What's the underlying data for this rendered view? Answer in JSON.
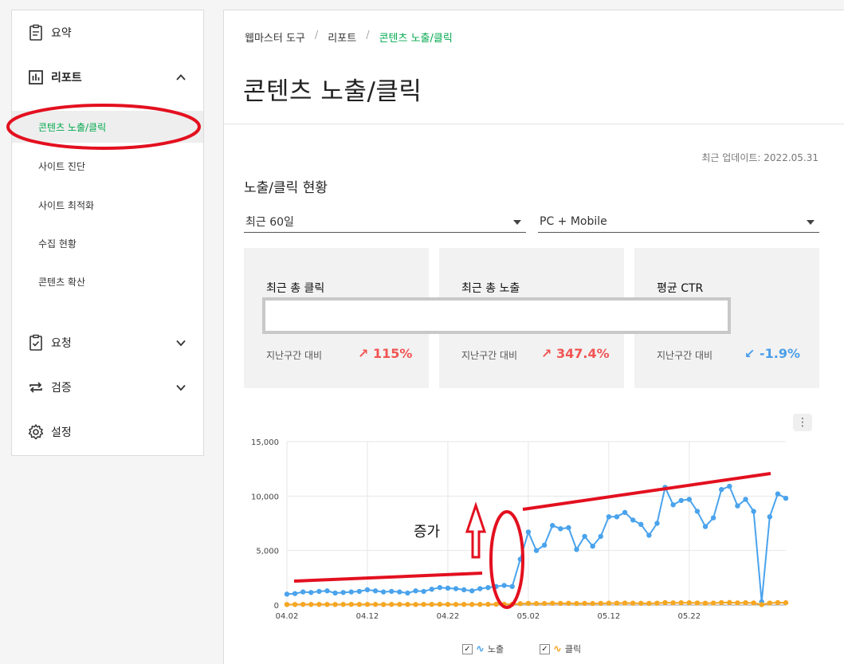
{
  "sidebar": {
    "summary": "요약",
    "report": "리포트",
    "report_sub": [
      "콘텐츠 노출/클릭",
      "사이트 진단",
      "사이트 최적화",
      "수집 현황",
      "콘텐츠 확산"
    ],
    "request": "요청",
    "verify": "검증",
    "settings": "설정"
  },
  "breadcrumb": [
    "웹마스터 도구",
    "리포트",
    "콘텐츠 노출/클릭"
  ],
  "page_title": "콘텐츠 노출/클릭",
  "last_updated": "최근 업데이트: 2022.05.31",
  "section_title": "노출/클릭 현황",
  "filters": {
    "period": "최근 60일",
    "device": "PC + Mobile"
  },
  "cards": [
    {
      "title": "최근 총 클릭",
      "label": "지난구간 대비",
      "change": "↗ 115%",
      "trend": "up"
    },
    {
      "title": "최근 총 노출",
      "label": "지난구간 대비",
      "change": "↗ 347.4%",
      "trend": "up"
    },
    {
      "title": "평균 CTR",
      "label": "지난구간 대비",
      "change": "↙ -1.9%",
      "trend": "down"
    }
  ],
  "menu_icon": "⋮",
  "annotation": "증가",
  "legend": [
    {
      "name": "노출",
      "color": "#4aa3ec",
      "checked": true
    },
    {
      "name": "클릭",
      "color": "#f5a623",
      "checked": true
    }
  ],
  "colors": {
    "accent": "#03a94f",
    "up": "#f25454",
    "down": "#4a9ee8",
    "annotation": "#e3101f"
  },
  "chart_data": {
    "type": "line",
    "x_tick_labels": [
      "04.02",
      "04.12",
      "04.22",
      "05.02",
      "05.12",
      "05.22"
    ],
    "y_tick_labels": [
      "0",
      "5,000",
      "10,000",
      "15,000"
    ],
    "ylim": [
      0,
      15000
    ],
    "grid": true,
    "legend": "bottom",
    "series": [
      {
        "name": "노출",
        "color": "#4aa3ec",
        "values": [
          1000,
          1050,
          1200,
          1150,
          1250,
          1300,
          1100,
          1150,
          1200,
          1250,
          1400,
          1300,
          1200,
          1250,
          1200,
          1100,
          1300,
          1250,
          1450,
          1600,
          1550,
          1500,
          1400,
          1300,
          1500,
          1600,
          1700,
          1800,
          1700,
          4200,
          6700,
          5000,
          5500,
          7300,
          7000,
          7100,
          5100,
          6300,
          5400,
          6300,
          8100,
          8100,
          8500,
          7800,
          7400,
          6400,
          7500,
          10800,
          9200,
          9600,
          9700,
          8600,
          7200,
          8000,
          10600,
          10900,
          9100,
          9700,
          8600,
          300,
          8100,
          10200,
          9800
        ]
      },
      {
        "name": "클릭",
        "color": "#f5a623",
        "values": [
          50,
          50,
          60,
          55,
          60,
          55,
          50,
          55,
          60,
          55,
          60,
          55,
          50,
          55,
          60,
          55,
          50,
          60,
          60,
          65,
          60,
          55,
          60,
          55,
          60,
          65,
          70,
          70,
          70,
          120,
          150,
          130,
          140,
          160,
          150,
          160,
          140,
          150,
          140,
          150,
          170,
          170,
          180,
          170,
          160,
          150,
          170,
          220,
          200,
          210,
          210,
          190,
          170,
          180,
          220,
          230,
          200,
          210,
          190,
          40,
          180,
          220,
          210
        ]
      }
    ]
  }
}
